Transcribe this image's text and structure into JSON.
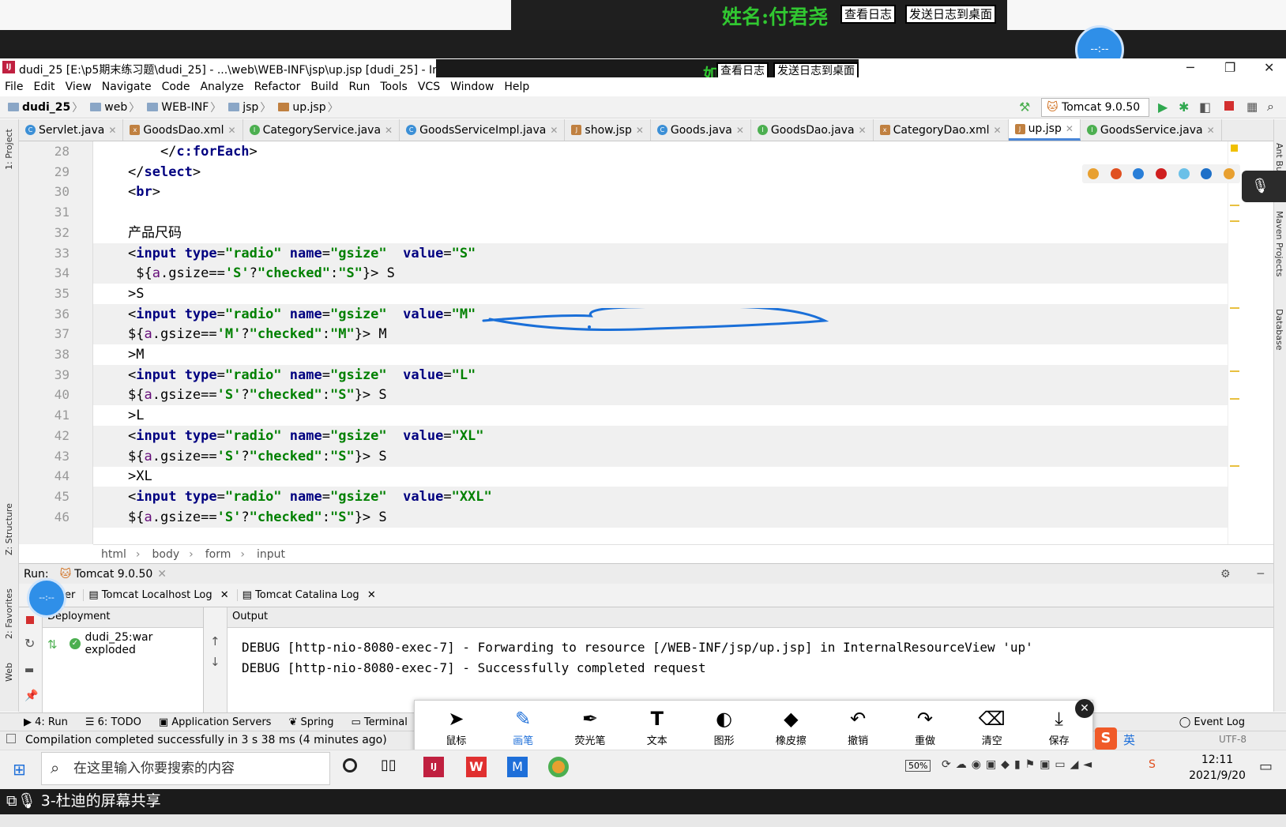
{
  "overlay": {
    "name_label": "姓名:付君尧",
    "view_log": "查看日志",
    "send_log": "发送日志到桌面",
    "name_label_short": "如"
  },
  "window": {
    "title": "dudi_25 [E:\\p5期末练习题\\dudi_25] - ...\\web\\WEB-INF\\jsp\\up.jsp [dudi_25] - IntelliJ IDEA",
    "icon": "intellij-icon"
  },
  "menu": [
    "File",
    "Edit",
    "View",
    "Navigate",
    "Code",
    "Analyze",
    "Refactor",
    "Build",
    "Run",
    "Tools",
    "VCS",
    "Window",
    "Help"
  ],
  "breadcrumb": [
    "dudi_25",
    "web",
    "WEB-INF",
    "jsp",
    "up.jsp"
  ],
  "run_config": "Tomcat 9.0.50",
  "tabs": [
    {
      "label": "Servlet.java",
      "color": "#3b8fd6",
      "letter": "C"
    },
    {
      "label": "GoodsDao.xml",
      "color": "#c08040",
      "letter": "x"
    },
    {
      "label": "CategoryService.java",
      "color": "#4caf50",
      "letter": "I"
    },
    {
      "label": "GoodsServiceImpl.java",
      "color": "#3b8fd6",
      "letter": "C"
    },
    {
      "label": "show.jsp",
      "color": "#c08040",
      "letter": "J"
    },
    {
      "label": "Goods.java",
      "color": "#3b8fd6",
      "letter": "C"
    },
    {
      "label": "GoodsDao.java",
      "color": "#4caf50",
      "letter": "I"
    },
    {
      "label": "CategoryDao.xml",
      "color": "#c08040",
      "letter": "x"
    },
    {
      "label": "up.jsp",
      "color": "#c08040",
      "letter": "J",
      "active": true
    },
    {
      "label": "GoodsService.java",
      "color": "#4caf50",
      "letter": "I"
    }
  ],
  "code_lines": [
    {
      "n": "28",
      "text": "    </c:forEach>"
    },
    {
      "n": "29",
      "text": "</select>"
    },
    {
      "n": "30",
      "text": "<br>"
    },
    {
      "n": "31",
      "text": ""
    },
    {
      "n": "32",
      "text": "产品尺码"
    },
    {
      "n": "33",
      "text": "<input type=\"radio\" name=\"gsize\"  value=\"S\""
    },
    {
      "n": "34",
      "text": " ${a.gsize=='S'?\"checked\":\"S\"}> S"
    },
    {
      "n": "35",
      "text": ">S"
    },
    {
      "n": "36",
      "text": "<input type=\"radio\" name=\"gsize\"  value=\"M\""
    },
    {
      "n": "37",
      "text": "${a.gsize=='M'?\"checked\":\"M\"}> M"
    },
    {
      "n": "38",
      "text": ">M"
    },
    {
      "n": "39",
      "text": "<input type=\"radio\" name=\"gsize\"  value=\"L\""
    },
    {
      "n": "40",
      "text": "${a.gsize=='S'?\"checked\":\"S\"}> S"
    },
    {
      "n": "41",
      "text": ">L"
    },
    {
      "n": "42",
      "text": "<input type=\"radio\" name=\"gsize\"  value=\"XL\""
    },
    {
      "n": "43",
      "text": "${a.gsize=='S'?\"checked\":\"S\"}> S"
    },
    {
      "n": "44",
      "text": ">XL"
    },
    {
      "n": "45",
      "text": "<input type=\"radio\" name=\"gsize\"  value=\"XXL\""
    },
    {
      "n": "46",
      "text": "${a.gsize=='S'?\"checked\":\"S\"}> S"
    }
  ],
  "editor_breadcrumb": [
    "html",
    "body",
    "form",
    "input"
  ],
  "run": {
    "label": "Run:",
    "config": "Tomcat 9.0.50",
    "tabs": [
      "er",
      "Tomcat Localhost Log",
      "Tomcat Catalina Log"
    ],
    "deployment_header": "Deployment",
    "deployment_item": "dudi_25:war exploded",
    "output_header": "Output",
    "log_lines": [
      "DEBUG [http-nio-8080-exec-7] - Forwarding to resource [/WEB-INF/jsp/up.jsp] in InternalResourceView 'up'",
      "DEBUG [http-nio-8080-exec-7] - Successfully completed request"
    ]
  },
  "bottom_tools": [
    "4: Run",
    "6: TODO",
    "Application Servers",
    "Spring",
    "Terminal"
  ],
  "event_log": "Event Log",
  "encoding": "UTF-8",
  "status": "Compilation completed successfully in 3 s 38 ms (4 minutes ago)",
  "side_labels": {
    "project": "1: Project",
    "structure": "Z: Structure",
    "favorites": "2: Favorites",
    "web": "Web",
    "ant": "Ant Build",
    "maven": "Maven Projects",
    "database": "Database"
  },
  "draw_tools": [
    {
      "label": "鼠标",
      "glyph": "➤"
    },
    {
      "label": "画笔",
      "glyph": "✎",
      "active": true
    },
    {
      "label": "荧光笔",
      "glyph": "✒"
    },
    {
      "label": "文本",
      "glyph": "T"
    },
    {
      "label": "图形",
      "glyph": "◐"
    },
    {
      "label": "橡皮擦",
      "glyph": "◆"
    },
    {
      "label": "撤销",
      "glyph": "↶"
    },
    {
      "label": "重做",
      "glyph": "↷"
    },
    {
      "label": "清空",
      "glyph": "🗑"
    },
    {
      "label": "保存",
      "glyph": "⤓"
    }
  ],
  "taskbar": {
    "search_placeholder": "在这里输入你要搜索的内容",
    "battery": "50%",
    "ime": "英",
    "time": "12:11",
    "date": "2021/9/20"
  },
  "share_label": "3-杜迪的屏幕共享",
  "bubble_text": "--:--",
  "colors": {
    "accent": "#2f8fe8",
    "annotation": "#1a6fd8",
    "name_green": "#31c731"
  }
}
